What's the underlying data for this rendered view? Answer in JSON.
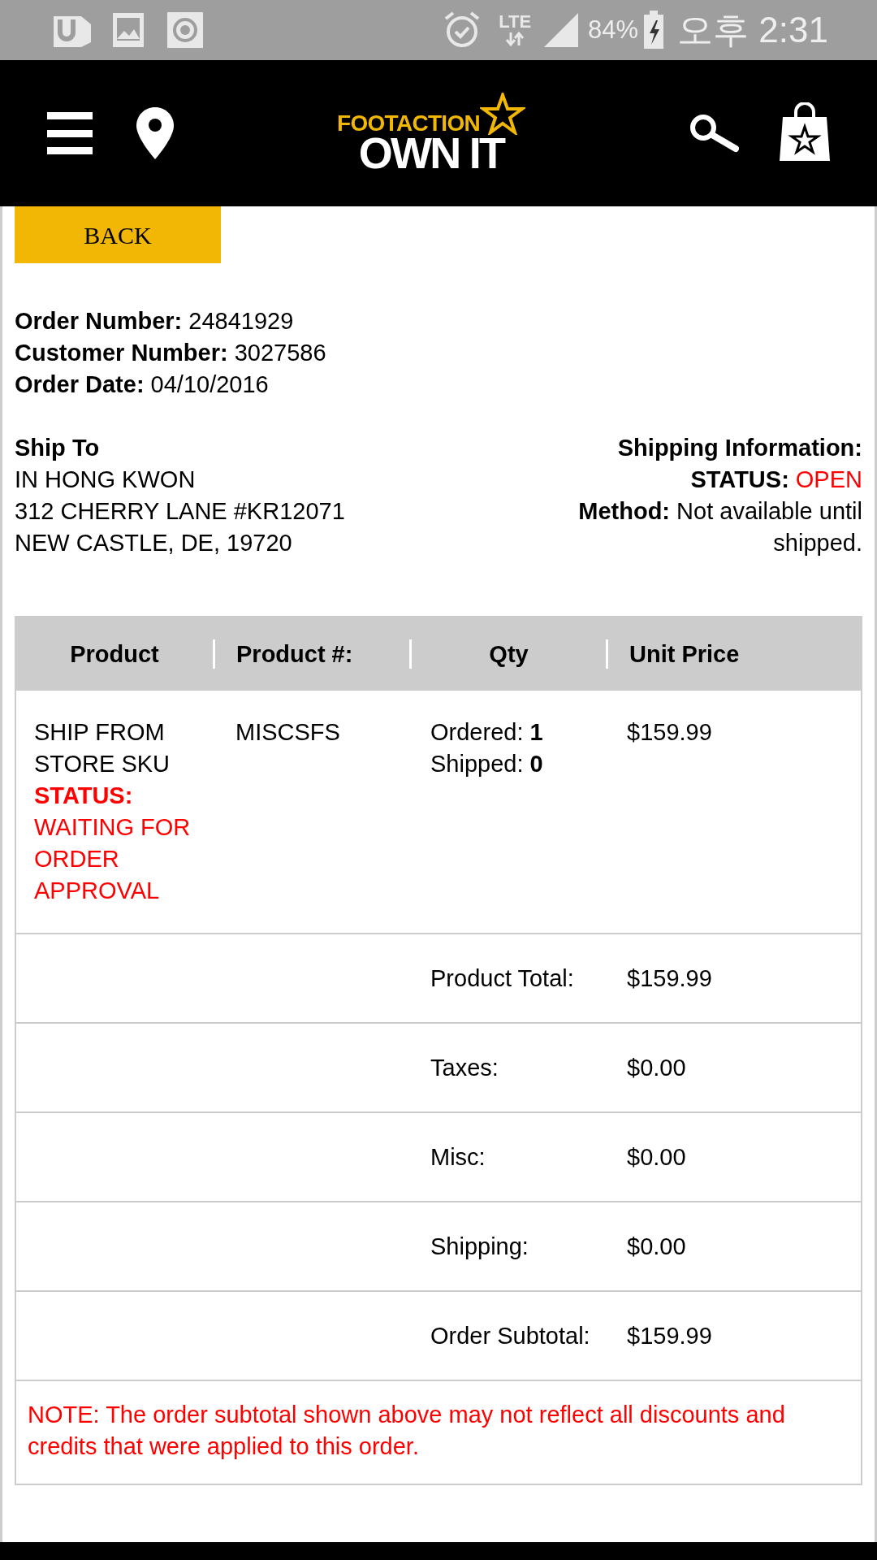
{
  "status_bar": {
    "network": "LTE",
    "battery": "84%",
    "time": "오후 2:31"
  },
  "header": {
    "logo_top": "FOOTACTION",
    "logo_bottom": "OWN IT"
  },
  "back_button": "BACK",
  "order_info": [
    "**Order Number:** 24841929",
    "**Customer Number:** 3027586",
    "**Order Date:** 04/10/2016"
  ],
  "ship_to": {
    "heading": "Ship To",
    "lines": [
      "IN HONG KWON",
      "312 CHERRY LANE #KR12071",
      "NEW CASTLE, DE, 19720"
    ]
  },
  "shipping_info": {
    "heading": "Shipping Information:",
    "status_label": "STATUS:",
    "status": "OPEN",
    "method": "**Method:** Not available until shipped."
  },
  "table": {
    "columns": [
      "Product",
      "Product #:",
      "Qty",
      "Unit Price"
    ],
    "rows": [
      {
        "product": "SHIP FROM STORE SKU",
        "status": "**STATUS:** WAITING FOR ORDER APPROVAL",
        "product_number": "MISCSFS",
        "ordered": "Ordered: **1**",
        "shipped": "Shipped: **0**",
        "unit_price": "$159.99"
      }
    ],
    "summary": [
      {
        "label": "Product Total:",
        "value": "$159.99"
      },
      {
        "label": "Taxes:",
        "value": "$0.00"
      },
      {
        "label": "Misc:",
        "value": "$0.00"
      },
      {
        "label": "Shipping:",
        "value": "$0.00"
      },
      {
        "label": "Order Subtotal:",
        "value": "$159.99"
      }
    ],
    "note": "NOTE: The order subtotal shown above may not reflect all discounts and credits that were applied to this order."
  }
}
